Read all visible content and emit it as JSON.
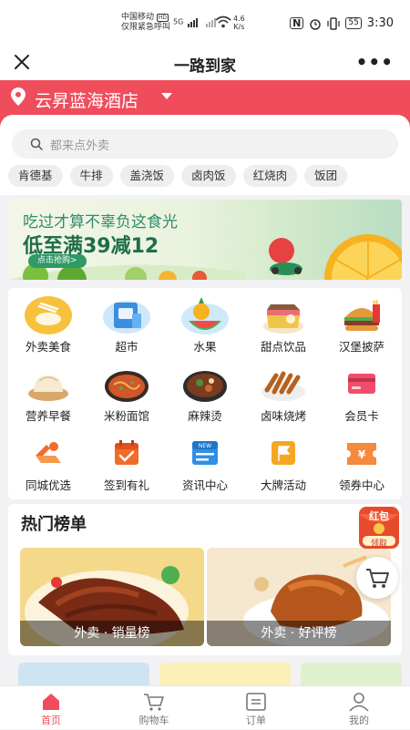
{
  "status_bar": {
    "carrier_line1": "中国移动",
    "carrier_badge": "HD",
    "carrier_line2": "仅限紧急呼叫",
    "network": "5G",
    "speed_value": "4.6",
    "speed_unit": "K/s",
    "nfc": "N",
    "battery": "55",
    "time": "3:30"
  },
  "titlebar": {
    "title": "一路到家",
    "close_icon": "close-icon",
    "more_icon": "more-icon"
  },
  "hotel": {
    "name": "云昇蓝海酒店",
    "accent": "#ef4d5c"
  },
  "search": {
    "placeholder": "都来点外卖"
  },
  "tags": [
    "肯德基",
    "牛排",
    "盖浇饭",
    "卤肉饭",
    "红烧肉",
    "饭团"
  ],
  "banner": {
    "line1": "吃过才算不辜负这食光",
    "line2": "低至满39减12",
    "button": "点击抢购>"
  },
  "categories": [
    {
      "label": "外卖美食",
      "icon": "takeout-food-icon"
    },
    {
      "label": "超市",
      "icon": "supermarket-icon"
    },
    {
      "label": "水果",
      "icon": "fruit-icon"
    },
    {
      "label": "甜点饮品",
      "icon": "dessert-drink-icon"
    },
    {
      "label": "汉堡披萨",
      "icon": "burger-pizza-icon"
    },
    {
      "label": "营养早餐",
      "icon": "breakfast-icon"
    },
    {
      "label": "米粉面馆",
      "icon": "noodles-icon"
    },
    {
      "label": "麻辣烫",
      "icon": "malatang-icon"
    },
    {
      "label": "卤味烧烤",
      "icon": "bbq-icon"
    },
    {
      "label": "会员卡",
      "icon": "member-card-icon"
    },
    {
      "label": "同城优选",
      "icon": "local-select-icon"
    },
    {
      "label": "签到有礼",
      "icon": "checkin-gift-icon"
    },
    {
      "label": "资讯中心",
      "icon": "news-center-icon"
    },
    {
      "label": "大牌活动",
      "icon": "brand-event-icon"
    },
    {
      "label": "领券中心",
      "icon": "coupon-center-icon"
    }
  ],
  "hot": {
    "title": "热门榜单",
    "items": [
      {
        "caption": "外卖 · 销量榜"
      },
      {
        "caption": "外卖 · 好评榜"
      }
    ]
  },
  "redpack": {
    "line1": "红包",
    "line2": "领取"
  },
  "tabs": [
    {
      "label": "首页",
      "icon": "home-icon",
      "active": true
    },
    {
      "label": "购物车",
      "icon": "cart-icon",
      "active": false
    },
    {
      "label": "订单",
      "icon": "order-icon",
      "active": false
    },
    {
      "label": "我的",
      "icon": "profile-icon",
      "active": false
    }
  ]
}
